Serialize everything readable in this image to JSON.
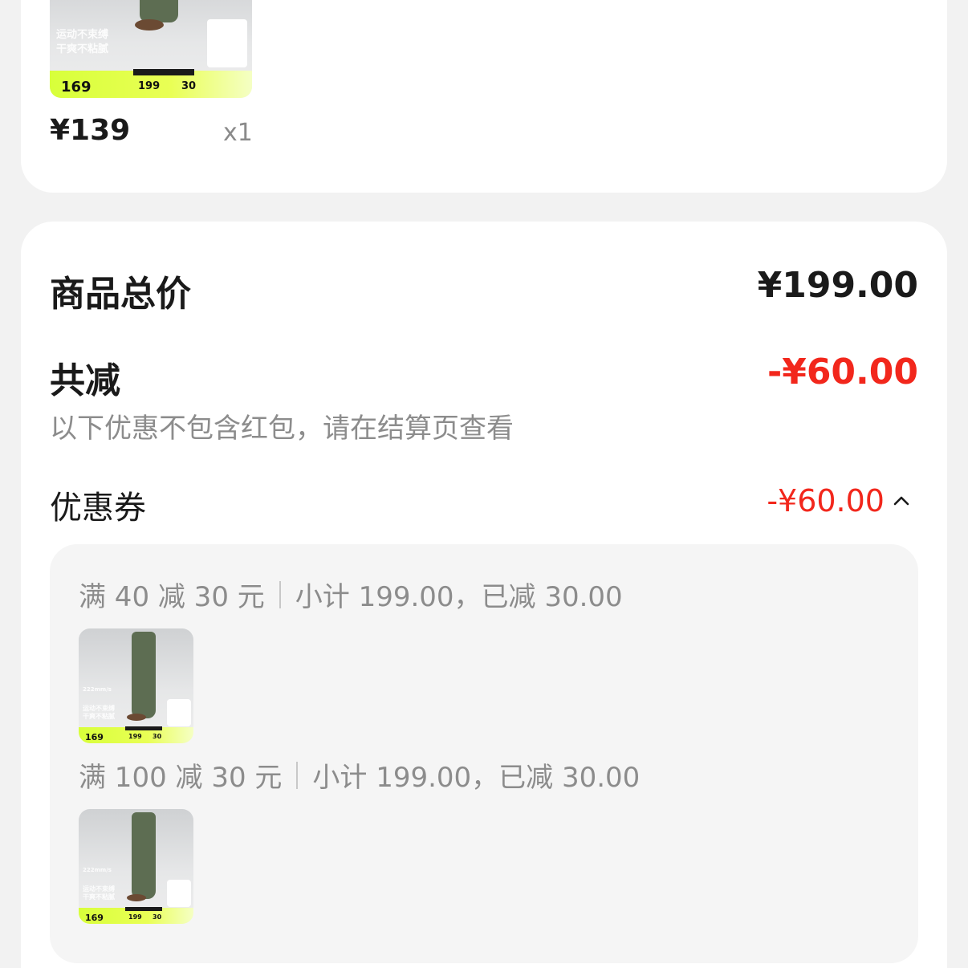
{
  "top_item": {
    "price": "¥139",
    "quantity": "x1",
    "image_promo": {
      "slogan_line1": "运动不束缚",
      "slogan_line2": "干爽不粘腻",
      "promo_price": "169",
      "equation_a": "199",
      "equation_b": "30",
      "speed_text": "222mm/s"
    }
  },
  "summary": {
    "total_label": "商品总价",
    "total_value": "¥199.00",
    "discount_label": "共减",
    "discount_value": "-¥60.00",
    "hint": "以下优惠不包含红包，请在结算页查看",
    "coupon_label": "优惠券",
    "coupon_value": "-¥60.00"
  },
  "coupons": [
    {
      "rule": "满 40 减 30 元",
      "detail": "小计 199.00，已减 30.00"
    },
    {
      "rule": "满 100 减 30 元",
      "detail": "小计 199.00，已减 30.00"
    }
  ],
  "colors": {
    "accent_red": "#f2271c",
    "text_dark": "#1a1a1a",
    "text_grey": "#8c8c8c",
    "background": "#f2f2f2",
    "card": "#ffffff",
    "promo_green": "#d8ff3a"
  },
  "icons": {
    "collapse": "chevron-up-icon"
  }
}
